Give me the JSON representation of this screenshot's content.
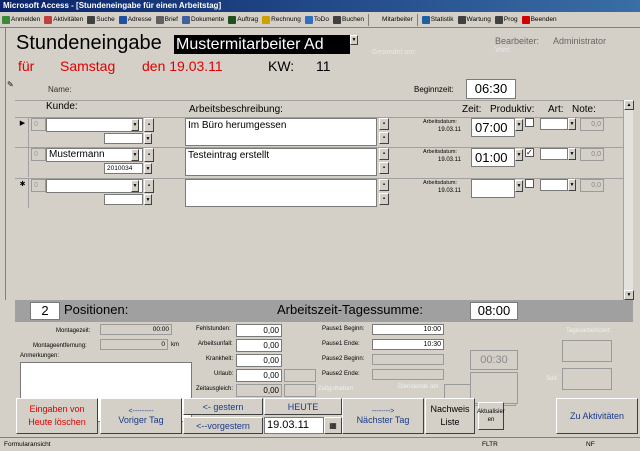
{
  "window": {
    "title": "Microsoft Access - [Stundeneingabe für einen Arbeitstag]"
  },
  "toolbar": [
    {
      "label": "Anmelden",
      "icon": "login-icon",
      "color": "#3a8a3a"
    },
    {
      "label": "Aktivitäten",
      "icon": "activities-icon",
      "color": "#c04040"
    },
    {
      "label": "Suche",
      "icon": "search-icon",
      "color": "#404040"
    },
    {
      "label": "Adresse",
      "icon": "address-icon",
      "color": "#2050a0"
    },
    {
      "label": "Brief",
      "icon": "letter-icon",
      "color": "#606060"
    },
    {
      "label": "Dokumente",
      "icon": "documents-icon",
      "color": "#4060a0"
    },
    {
      "label": "Auftrag",
      "icon": "order-icon",
      "color": "#205020"
    },
    {
      "label": "Rechnung",
      "icon": "invoice-icon",
      "color": "#d0a000"
    },
    {
      "label": "ToDo",
      "icon": "todo-icon",
      "color": "#3070c0"
    },
    {
      "label": "Buchen",
      "icon": "booking-icon",
      "color": "#404040"
    },
    {
      "label": "Mitarbeiter",
      "icon": "staff-dropdown-icon",
      "color": "#d4d0c8"
    },
    {
      "label": "Statistik",
      "icon": "statistics-icon",
      "color": "#2060a0"
    },
    {
      "label": "Wartung",
      "icon": "maintenance-icon",
      "color": "#404040"
    },
    {
      "label": "Prog",
      "icon": "program-icon",
      "color": "#404040"
    },
    {
      "label": "Beenden",
      "icon": "exit-icon",
      "color": "#d00000"
    }
  ],
  "header": {
    "title": "Stundeneingabe",
    "employee": "Mustermitarbeiter Ad",
    "line2_fuer": "für",
    "weekday": "Samstag",
    "den": "den 19.03.11",
    "kw_label": "KW:",
    "kw_value": "11",
    "editor_label": "Bearbeiter:",
    "editor_value": "Administrator",
    "greyed_label": "Gesendet am:",
    "greyed_value2": "Vom:"
  },
  "name_row": {
    "name_label": "Name:",
    "start_label": "Beginnzeit:",
    "start_value": "06:30"
  },
  "columns": {
    "kunde": "Kunde:",
    "beschreibung": "Arbeitsbeschreibung:",
    "zeit": "Zeit:",
    "produktiv": "Produktiv:",
    "art": "Art:",
    "note": "Note:"
  },
  "rows": [
    {
      "marker": "▶",
      "num": "0",
      "kunde": "",
      "sub": "",
      "beschreibung": "Im Büro herumgessen",
      "datum_label": "Arbeitsdatum:",
      "datum": "19.03.11",
      "zeit": "07:00",
      "produktiv": false,
      "note": "0,0"
    },
    {
      "marker": "",
      "num": "0",
      "kunde": "Mustermann",
      "sub": "2010034",
      "beschreibung": "Testeintrag erstellt",
      "datum_label": "Arbeitsdatum:",
      "datum": "19.03.11",
      "zeit": "01:00",
      "produktiv": true,
      "note": "0,0"
    },
    {
      "marker": "✱",
      "num": "0",
      "kunde": "",
      "sub": "",
      "beschreibung": "",
      "datum_label": "Arbeitsdatum:",
      "datum": "19.03.11",
      "zeit": "",
      "produktiv": false,
      "note": "0,0"
    }
  ],
  "summary": {
    "count": "2",
    "positions_label": "Positionen:",
    "sum_label": "Arbeitszeit-Tagessumme:",
    "sum_value": "08:00"
  },
  "bottom": {
    "montagezeit_label": "Montagezeit:",
    "montagezeit_value": "00:00",
    "entfernung_label": "Montageentfernung:",
    "entfernung_value": "0",
    "entfernung_unit": "km",
    "anmerkungen_label": "Anmerkungen:",
    "fehlstunden_label": "Fehlstunden:",
    "fehlstunden_value": "0,00",
    "arbeitsunfall_label": "Arbeitsunfall:",
    "arbeitsunfall_value": "0,00",
    "krankheit_label": "Krankheit:",
    "krankheit_value": "0,00",
    "urlaub_label": "Urlaub:",
    "urlaub_value": "0,00",
    "zeitausgleich_label": "Zeitausgleich:",
    "zeitausgleich_value": "0,00",
    "pause1_beginn_label": "Pause1 Beginn:",
    "pause1_beginn_value": "10:00",
    "pause1_ende_label": "Pause1 Ende:",
    "pause1_ende_value": "10:30",
    "pause2_beginn_label": "Pause2 Beginn:",
    "pause2_ende_label": "Pause2 Ende:",
    "pause_total": "00:30",
    "zeitgutschrift_label": "Zeitgutheben",
    "dienstende_label": "Dienstende am:",
    "tagesarbeit_label": "Tagesarbeitszeit:",
    "soll_label": "Soll:"
  },
  "nav": {
    "clear": "Eingaben von Heute löschen",
    "prev_arrow": "<---------",
    "prev": "Voriger Tag",
    "gestern": "<- gestern",
    "vorgestern": "<--vorgestern",
    "heute": "HEUTE",
    "date": "19.03.11",
    "next_arrow": "-------->",
    "next": "Nächster Tag",
    "nachweis": "Nachweis Liste",
    "aktualisieren": "Aktualisier en",
    "zu_aktivitaeten": "Zu Aktivitäten"
  },
  "status": {
    "left": "Formularansicht",
    "flt": "FLTR",
    "nf": "NF"
  }
}
